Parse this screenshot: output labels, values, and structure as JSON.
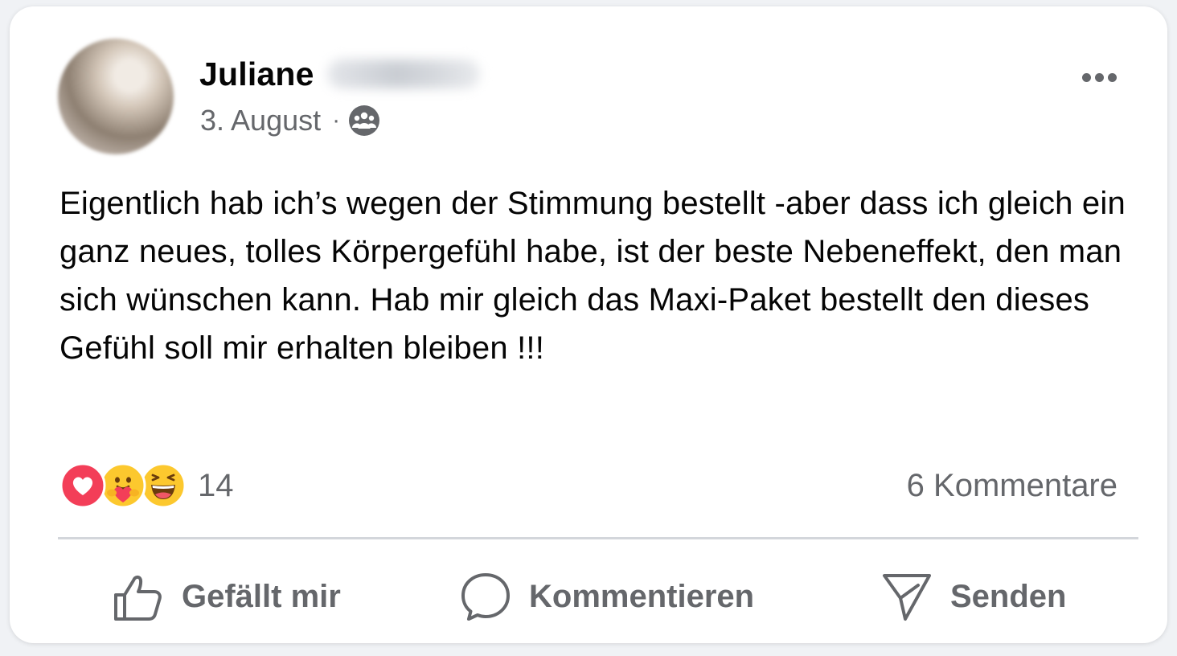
{
  "author": {
    "first_name": "Juliane",
    "last_name_redacted": true
  },
  "post": {
    "date": "3. August",
    "separator": "·",
    "audience_icon": "group-audience-icon",
    "text": "Eigentlich hab ich’s wegen der Stimmung bestellt -aber dass ich gleich ein ganz neues, tolles Körpergefühl habe, ist der beste Nebeneffekt, den man sich wünschen kann. Hab mir gleich das Maxi-Paket bestellt den dieses Gefühl soll mir erhalten bleiben !!!"
  },
  "reactions": {
    "icons": [
      "love-reaction-icon",
      "care-reaction-icon",
      "haha-reaction-icon"
    ],
    "count": "14",
    "comments": "6 Kommentare"
  },
  "actions": {
    "like": "Gefällt mir",
    "comment": "Kommentieren",
    "send": "Senden"
  },
  "colors": {
    "text_primary": "#050505",
    "text_secondary": "#65676b",
    "love": "#f33e58",
    "emoji_yellow": "#fcc82e"
  }
}
